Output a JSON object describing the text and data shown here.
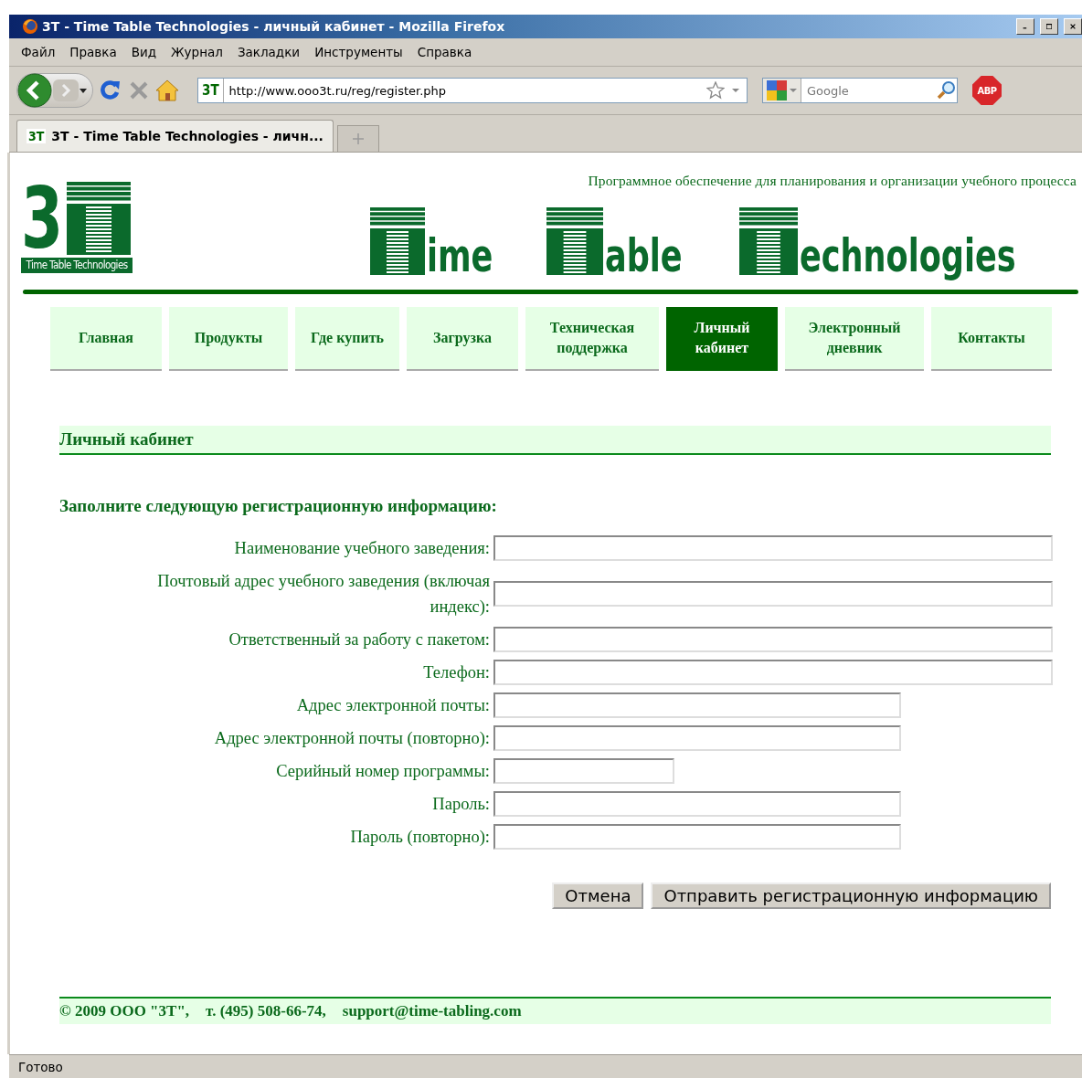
{
  "window": {
    "title": "3T - Time Table Technologies - личный кабинет - Mozilla Firefox"
  },
  "menu": [
    "Файл",
    "Правка",
    "Вид",
    "Журнал",
    "Закладки",
    "Инструменты",
    "Справка"
  ],
  "address_bar": {
    "site_badge": "3T",
    "url": "http://www.ooo3t.ru/reg/register.php"
  },
  "search": {
    "placeholder": "Google"
  },
  "adblock_button": "ABP",
  "tabs": [
    {
      "badge": "3T",
      "label": "3T - Time Table Technologies - личн...",
      "selected": true
    }
  ],
  "header": {
    "logo_mark": "3",
    "logo_caption": "Time Table Technologies",
    "tagline": "Программное обеспечение для планирования и организации учебного процесса",
    "banner_words": [
      "ime",
      "able",
      "echnologies"
    ]
  },
  "nav": [
    {
      "label": "Главная",
      "selected": false
    },
    {
      "label": "Продукты",
      "selected": false
    },
    {
      "label": "Где купить",
      "selected": false
    },
    {
      "label": "Загрузка",
      "selected": false
    },
    {
      "label": "Техническая поддержка",
      "selected": false
    },
    {
      "label": "Личный кабинет",
      "selected": true
    },
    {
      "label": "Электронный дневник",
      "selected": false
    },
    {
      "label": "Контакты",
      "selected": false
    }
  ],
  "section_title": "Личный кабинет",
  "form": {
    "heading": "Заполните следующую регистрационную информацию:",
    "fields": [
      {
        "label": "Наименование учебного заведения:",
        "kind": "long"
      },
      {
        "label": "Почтовый адрес учебного заведения (включая индекс):",
        "kind": "long"
      },
      {
        "label": "Ответственный за работу с пакетом:",
        "kind": "long"
      },
      {
        "label": "Телефон:",
        "kind": "long"
      },
      {
        "label": "Адрес электронной почты:",
        "kind": "medium"
      },
      {
        "label": "Адрес электронной почты (повторно):",
        "kind": "medium"
      },
      {
        "label": "Серийный номер программы:",
        "kind": "short"
      },
      {
        "label": "Пароль:",
        "kind": "medium"
      },
      {
        "label": "Пароль (повторно):",
        "kind": "medium"
      }
    ],
    "buttons": [
      "Отмена",
      "Отправить регистрационную информацию"
    ]
  },
  "footer": {
    "copyright": "© 2009 ООО \"3Т\",",
    "phone": "т. (495) 508-66-74,",
    "email": "support@time-tabling.com"
  },
  "status_bar": {
    "text": "Готово"
  }
}
